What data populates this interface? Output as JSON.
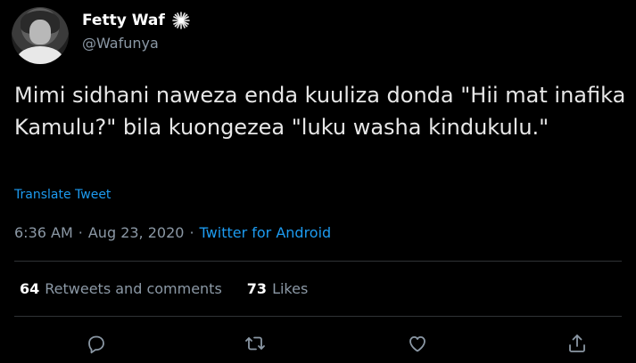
{
  "user": {
    "display_name": "Fetty Waf",
    "handle": "@Wafunya",
    "badge_icon": "sparkle-burst-icon"
  },
  "tweet": {
    "text": "Mimi sidhani naweza enda kuuliza donda \"Hii mat inafika Kamulu?\" bila kuongezea \"luku washa kindukulu.\"",
    "translate_label": "Translate Tweet"
  },
  "meta": {
    "time": "6:36 AM",
    "date": "Aug 23, 2020",
    "separator": "·",
    "source": "Twitter for Android"
  },
  "stats": {
    "retweets_count": "64",
    "retweets_label": "Retweets and comments",
    "likes_count": "73",
    "likes_label": "Likes"
  },
  "actions": {
    "reply_icon": "reply-icon",
    "retweet_icon": "retweet-icon",
    "like_icon": "heart-icon",
    "share_icon": "share-icon"
  },
  "colors": {
    "background": "#000000",
    "accent": "#1d9bf0",
    "secondary_text": "#8b98a5"
  }
}
